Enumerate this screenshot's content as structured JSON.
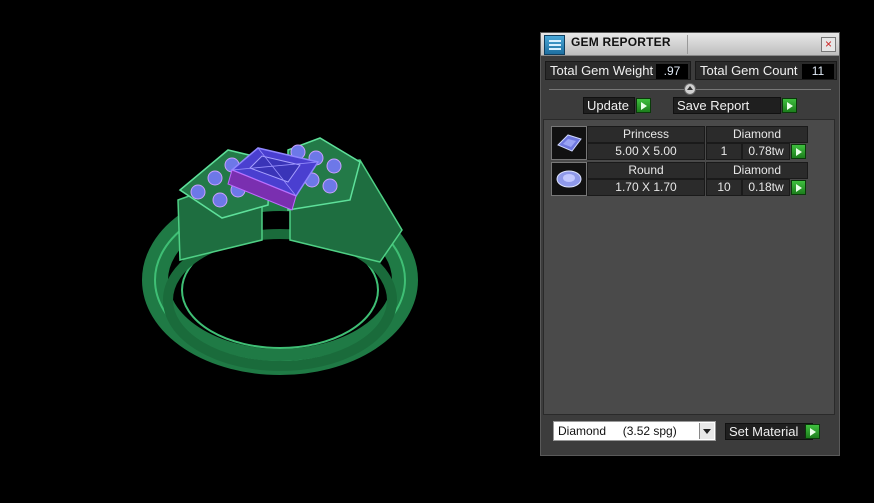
{
  "viewport": {
    "label": "ring-3d-model"
  },
  "panel": {
    "title": "GEM REPORTER",
    "close_label": "×",
    "total_weight_label": "Total Gem Weight",
    "total_weight_value": ".97",
    "total_count_label": "Total Gem Count",
    "total_count_value": "11",
    "update_label": "Update",
    "save_report_label": "Save Report",
    "gems": [
      {
        "shape": "Princess",
        "material": "Diamond",
        "size": "5.00 X 5.00",
        "count": "1",
        "weight": "0.78tw"
      },
      {
        "shape": "Round",
        "material": "Diamond",
        "size": "1.70 X 1.70",
        "count": "10",
        "weight": "0.18tw"
      }
    ],
    "material_select_value": "Diamond     (3.52 spg)",
    "set_material_label": "Set Material"
  },
  "colors": {
    "ring": "#2e8b57",
    "stone": "#5a52d6",
    "panel": "#3c3c3c"
  }
}
